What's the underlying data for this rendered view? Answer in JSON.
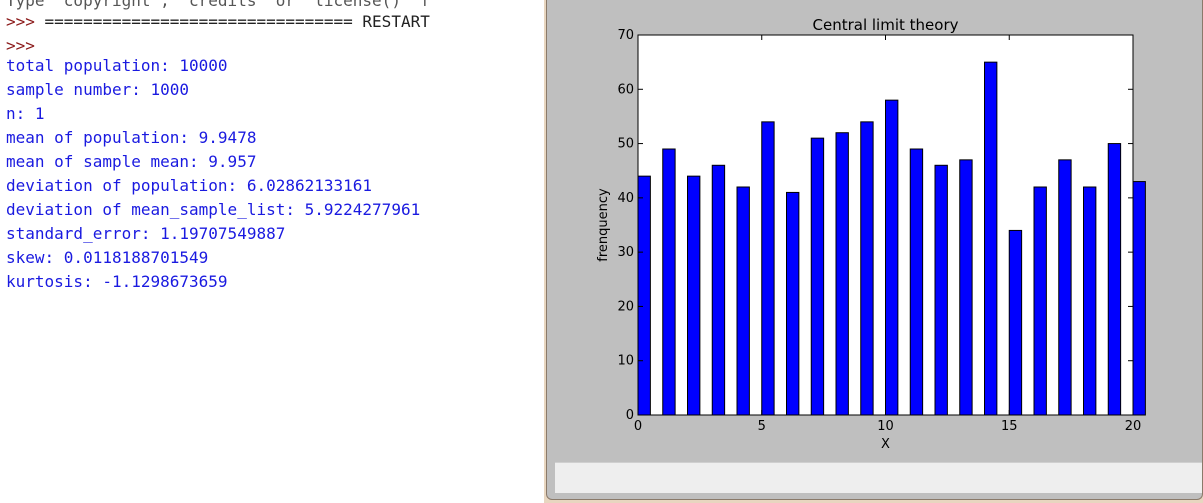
{
  "shell": {
    "banner_line": "Type \"copyright\", \"credits\" or \"license()\" f",
    "restart_prompt": ">>> ",
    "restart_text": "================================ RESTART",
    "prompt2": ">>>",
    "output": [
      "total population: 10000",
      "sample number: 1000",
      "n: 1",
      "mean of population: 9.9478",
      "mean of sample mean: 9.957",
      "deviation of population: 6.02862133161",
      "deviation of mean_sample_list: 5.9224277961",
      "standard_error: 1.19707549887",
      "skew: 0.0118188701549",
      "kurtosis: -1.1298673659"
    ]
  },
  "colors": {
    "bar_fill": "#0000ff",
    "shell_output": "#1a1ae0",
    "prompt": "#8b1a1a"
  },
  "chart_data": {
    "type": "bar",
    "title": "Central limit theory",
    "xlabel": "X",
    "ylabel": "frenquency",
    "xlim": [
      0,
      20
    ],
    "ylim": [
      0,
      70
    ],
    "x_ticks": [
      0,
      5,
      10,
      15,
      20
    ],
    "y_ticks": [
      0,
      10,
      20,
      30,
      40,
      50,
      60,
      70
    ],
    "x": [
      0,
      1,
      2,
      3,
      4,
      5,
      6,
      7,
      8,
      9,
      10,
      11,
      12,
      13,
      14,
      15,
      16,
      17,
      18,
      19,
      20
    ],
    "values": [
      44,
      49,
      44,
      46,
      42,
      54,
      41,
      51,
      52,
      54,
      58,
      49,
      46,
      47,
      65,
      34,
      42,
      47,
      42,
      50,
      43
    ],
    "grid": false
  }
}
